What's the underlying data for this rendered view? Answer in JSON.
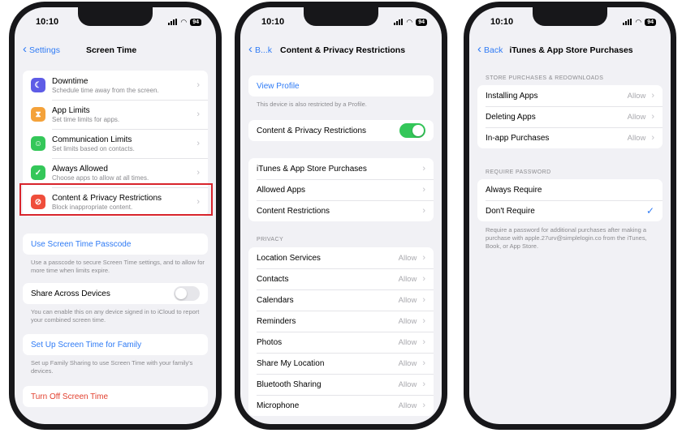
{
  "status": {
    "time": "10:10",
    "battery": "94"
  },
  "phone1": {
    "back": "Settings",
    "title": "Screen Time",
    "items": [
      {
        "title": "Downtime",
        "subtitle": "Schedule time away from the screen.",
        "icon": "moon-icon",
        "color": "#5e5ce6"
      },
      {
        "title": "App Limits",
        "subtitle": "Set time limits for apps.",
        "icon": "hourglass-icon",
        "color": "#f4a23a"
      },
      {
        "title": "Communication Limits",
        "subtitle": "Set limits based on contacts.",
        "icon": "person-icon",
        "color": "#34c759"
      },
      {
        "title": "Always Allowed",
        "subtitle": "Choose apps to allow at all times.",
        "icon": "checkmark-icon",
        "color": "#34c759"
      },
      {
        "title": "Content & Privacy Restrictions",
        "subtitle": "Block inappropriate content.",
        "icon": "restriction-icon",
        "color": "#ef4e3b"
      }
    ],
    "passcode": "Use Screen Time Passcode",
    "passcode_footer": "Use a passcode to secure Screen Time settings, and to allow for more time when limits expire.",
    "share": "Share Across Devices",
    "share_footer": "You can enable this on any device signed in to iCloud to report your combined screen time.",
    "family": "Set Up Screen Time for Family",
    "family_footer": "Set up Family Sharing to use Screen Time with your family's devices.",
    "turnoff": "Turn Off Screen Time",
    "highlight_color": "#d8242c"
  },
  "phone2": {
    "back": "B...k",
    "title": "Content & Privacy Restrictions",
    "view_profile": "View Profile",
    "profile_footer": "This device is also restricted by a Profile.",
    "cpr_toggle": "Content & Privacy Restrictions",
    "items1": [
      "iTunes & App Store Purchases",
      "Allowed Apps",
      "Content Restrictions"
    ],
    "privacy_header": "PRIVACY",
    "privacy": [
      {
        "label": "Location Services",
        "value": "Allow"
      },
      {
        "label": "Contacts",
        "value": "Allow"
      },
      {
        "label": "Calendars",
        "value": "Allow"
      },
      {
        "label": "Reminders",
        "value": "Allow"
      },
      {
        "label": "Photos",
        "value": "Allow"
      },
      {
        "label": "Share My Location",
        "value": "Allow"
      },
      {
        "label": "Bluetooth Sharing",
        "value": "Allow"
      },
      {
        "label": "Microphone",
        "value": "Allow"
      }
    ]
  },
  "phone3": {
    "back": "Back",
    "title": "iTunes & App Store Purchases",
    "store_header": "STORE PURCHASES & REDOWNLOADS",
    "store": [
      {
        "label": "Installing Apps",
        "value": "Allow"
      },
      {
        "label": "Deleting Apps",
        "value": "Allow"
      },
      {
        "label": "In-app Purchases",
        "value": "Allow"
      }
    ],
    "pw_header": "REQUIRE PASSWORD",
    "always": "Always Require",
    "dont": "Don't Require",
    "pw_footer": "Require a password for additional purchases after making a purchase with apple.27urv@simplelogin.co from the iTunes, Book, or App Store."
  }
}
